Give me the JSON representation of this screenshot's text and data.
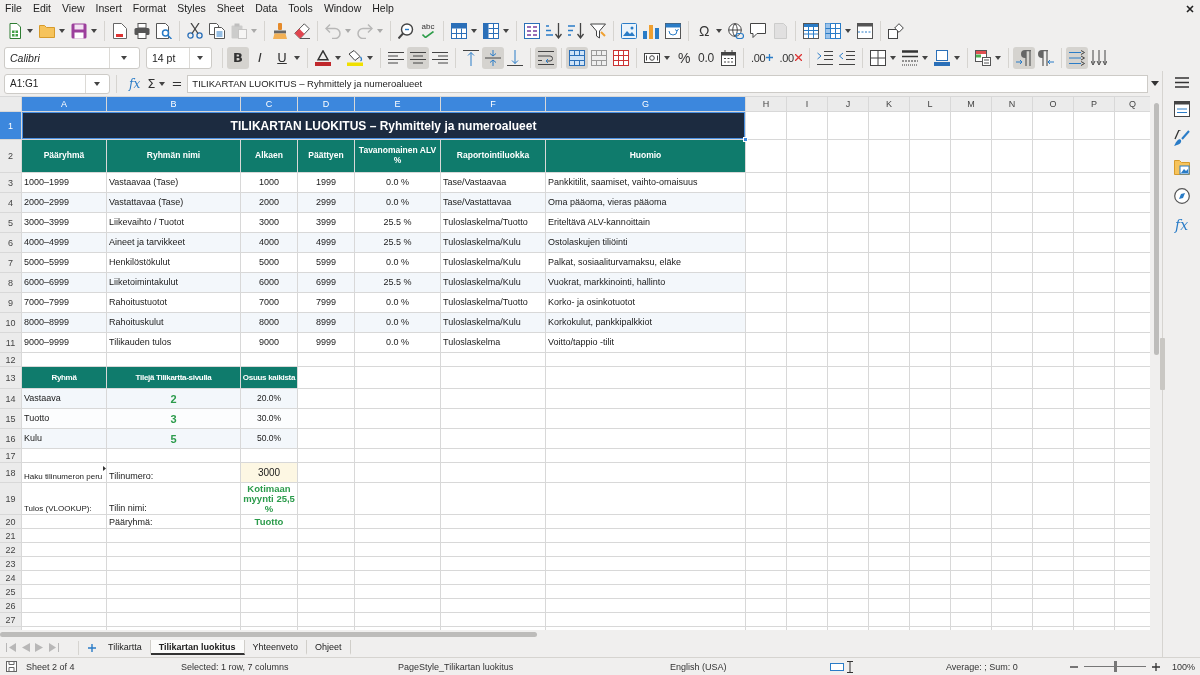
{
  "menu": [
    "File",
    "Edit",
    "View",
    "Insert",
    "Format",
    "Styles",
    "Sheet",
    "Data",
    "Tools",
    "Window",
    "Help"
  ],
  "standard_toolbar": {
    "paste_disabled": true,
    "undo_disabled": true,
    "redo_disabled": true,
    "header_footer_disabled": true,
    "spelling_label": "abc",
    "special_character_label": "Ω"
  },
  "formatting_toolbar": {
    "font_name": "Calibri",
    "font_size": "14 pt",
    "bold_label": "B",
    "bold_on": true,
    "italic_label": "I",
    "italic_on": false,
    "underline_label": "U",
    "underline_on": false,
    "align_left_on": false,
    "align_center_on": true,
    "align_right_on": false,
    "align_top_on": false,
    "align_middle_on": true,
    "align_bottom_on": false,
    "wrap_text_on": true,
    "merge_and_center_on": true,
    "percent_label": "%",
    "number_label": "0.0",
    "add_decimal_label": ".00",
    "delete_decimal_label": ".00",
    "paragraph_ltr_on": true,
    "paragraph_rtl_on": false,
    "text_ltr_on": true
  },
  "formula_bar": {
    "name_box": "A1:G1",
    "function_label": "fx",
    "sum_label": "Σ",
    "equals_label": "=",
    "content": "TILIKARTAN LUOKITUS – Ryhmittely ja numeroalueet"
  },
  "sheet": {
    "columns": [
      {
        "label": "A",
        "selected": true
      },
      {
        "label": "B",
        "selected": true
      },
      {
        "label": "C",
        "selected": true
      },
      {
        "label": "D",
        "selected": true
      },
      {
        "label": "E",
        "selected": true
      },
      {
        "label": "F",
        "selected": true
      },
      {
        "label": "G",
        "selected": true
      },
      {
        "label": "H",
        "selected": false
      },
      {
        "label": "I",
        "selected": false
      },
      {
        "label": "J",
        "selected": false
      },
      {
        "label": "K",
        "selected": false
      },
      {
        "label": "L",
        "selected": false
      },
      {
        "label": "M",
        "selected": false
      },
      {
        "label": "N",
        "selected": false
      },
      {
        "label": "O",
        "selected": false
      },
      {
        "label": "P",
        "selected": false
      },
      {
        "label": "Q",
        "selected": false
      }
    ],
    "row_headers": [
      {
        "label": "1",
        "selected": true
      },
      {
        "label": "2",
        "selected": false
      },
      {
        "label": "3",
        "selected": false
      },
      {
        "label": "4",
        "selected": false
      },
      {
        "label": "5",
        "selected": false
      },
      {
        "label": "6",
        "selected": false
      },
      {
        "label": "7",
        "selected": false
      },
      {
        "label": "8",
        "selected": false
      },
      {
        "label": "9",
        "selected": false
      },
      {
        "label": "10",
        "selected": false
      },
      {
        "label": "11",
        "selected": false
      },
      {
        "label": "12",
        "selected": false
      },
      {
        "label": "13",
        "selected": false
      },
      {
        "label": "14",
        "selected": false
      },
      {
        "label": "15",
        "selected": false
      },
      {
        "label": "16",
        "selected": false
      },
      {
        "label": "17",
        "selected": false
      },
      {
        "label": "18",
        "selected": false
      },
      {
        "label": "19",
        "selected": false
      },
      {
        "label": "20",
        "selected": false
      },
      {
        "label": "21",
        "selected": false
      },
      {
        "label": "22",
        "selected": false
      },
      {
        "label": "23",
        "selected": false
      },
      {
        "label": "24",
        "selected": false
      },
      {
        "label": "25",
        "selected": false
      },
      {
        "label": "26",
        "selected": false
      },
      {
        "label": "27",
        "selected": false
      }
    ],
    "title": {
      "text": "TILIKARTAN LUOKITUS – Ryhmittely ja numeroalueet",
      "selected": true
    },
    "header": [
      "Pääryhmä",
      "Ryhmän nimi",
      "Alkaen",
      "Päättyen",
      "Tavanomainen ALV %",
      "Raportointiluokka",
      "Huomio"
    ],
    "groups": [
      {
        "range": "1000–1999",
        "name": "Vastaavaa (Tase)",
        "start": "1000",
        "end": "1999",
        "vat": "0.0 %",
        "report_class": "Tase/Vastaavaa",
        "note": "Pankkitilit, saamiset, vaihto-omaisuus"
      },
      {
        "range": "2000–2999",
        "name": "Vastattavaa (Tase)",
        "start": "2000",
        "end": "2999",
        "vat": "0.0 %",
        "report_class": "Tase/Vastattavaa",
        "note": "Oma pääoma, vieras pääoma"
      },
      {
        "range": "3000–3999",
        "name": "Liikevaihto / Tuotot",
        "start": "3000",
        "end": "3999",
        "vat": "25.5 %",
        "report_class": "Tuloslaskelma/Tuotto",
        "note": "Eriteltävä ALV-kannoittain"
      },
      {
        "range": "4000–4999",
        "name": "Aineet ja tarvikkeet",
        "start": "4000",
        "end": "4999",
        "vat": "25.5 %",
        "report_class": "Tuloslaskelma/Kulu",
        "note": "Ostolaskujen tiliöinti"
      },
      {
        "range": "5000–5999",
        "name": "Henkilöstökulut",
        "start": "5000",
        "end": "5999",
        "vat": "0.0 %",
        "report_class": "Tuloslaskelma/Kulu",
        "note": "Palkat, sosiaaliturvamaksu, eläke"
      },
      {
        "range": "6000–6999",
        "name": "Liiketoimintakulut",
        "start": "6000",
        "end": "6999",
        "vat": "25.5 %",
        "report_class": "Tuloslaskelma/Kulu",
        "note": "Vuokrat, markkinointi, hallinto"
      },
      {
        "range": "7000–7999",
        "name": "Rahoitustuotot",
        "start": "7000",
        "end": "7999",
        "vat": "0.0 %",
        "report_class": "Tuloslaskelma/Tuotto",
        "note": "Korko- ja osinkotuotot"
      },
      {
        "range": "8000–8999",
        "name": "Rahoituskulut",
        "start": "8000",
        "end": "8999",
        "vat": "0.0 %",
        "report_class": "Tuloslaskelma/Kulu",
        "note": "Korkokulut, pankkipalkkiot"
      },
      {
        "range": "9000–9999",
        "name": "Tilikauden tulos",
        "start": "9000",
        "end": "9999",
        "vat": "0.0 %",
        "report_class": "Tuloslaskelma",
        "note": "Voitto/tappio -tilit"
      }
    ],
    "summary": {
      "header": [
        "Ryhmä",
        "Tilejä Tilikartta-sivulla",
        "Osuus kaikista"
      ],
      "rows": [
        {
          "group": "Vastaava",
          "count": "2",
          "share": "20.0%"
        },
        {
          "group": "Tuotto",
          "count": "3",
          "share": "30.0%"
        },
        {
          "group": "Kulu",
          "count": "5",
          "share": "50.0%"
        }
      ]
    },
    "lookup": [
      {
        "label": "Haku tilinumeron peru",
        "overflows": true,
        "field": "Tilinumero:",
        "value": "3000",
        "kind": "input"
      },
      {
        "label": "Tulos (VLOOKUP):",
        "overflows": false,
        "field": "Tilin nimi:",
        "value": "Kotimaan myynti 25,5 %",
        "kind": "result"
      },
      {
        "field": "Pääryhmä:",
        "value": "Tuotto",
        "kind": "result"
      }
    ]
  },
  "sheet_tabs": [
    {
      "label": "Tilikartta",
      "selected": false
    },
    {
      "label": "Tilikartan luokitus",
      "selected": true
    },
    {
      "label": "Yhteenveto",
      "selected": false
    },
    {
      "label": "Ohjeet",
      "selected": false
    }
  ],
  "sidebar": {
    "functions_label": "fx"
  },
  "status_bar": {
    "sheet": "Sheet 2 of 4",
    "selection": "Selected: 1 row, 7 columns",
    "page_style": "PageStyle_Tilikartan luokitus",
    "language": "English (USA)",
    "statistics": "Average: ; Sum: 0",
    "zoom": "100%",
    "zoom_slider": {
      "level": 0.5
    }
  }
}
